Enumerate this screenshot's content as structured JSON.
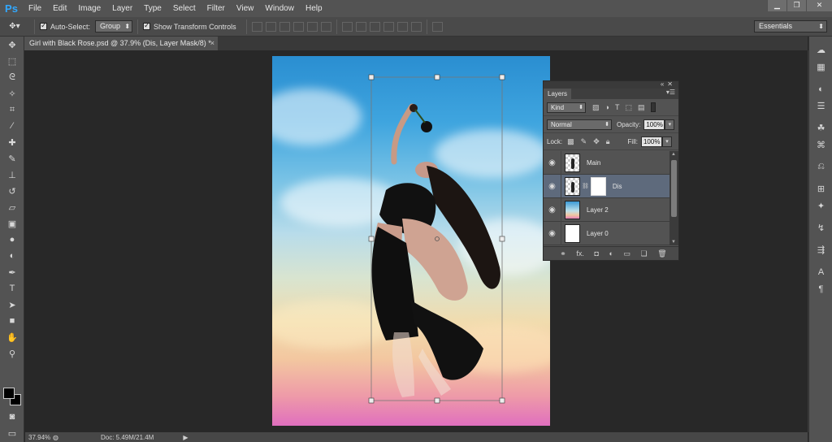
{
  "app": {
    "logo": "Ps"
  },
  "menu": {
    "items": [
      "File",
      "Edit",
      "Image",
      "Layer",
      "Type",
      "Select",
      "Filter",
      "View",
      "Window",
      "Help"
    ]
  },
  "window_controls": {
    "minimize": "▁",
    "restore": "❐",
    "close": "✕"
  },
  "options_bar": {
    "auto_select_label": "Auto-Select:",
    "auto_select_checked": true,
    "auto_select_target": "Group",
    "show_transform_label": "Show Transform Controls",
    "show_transform_checked": true,
    "workspace": "Essentials"
  },
  "document": {
    "tab_title": "Girl with Black Rose.psd @ 37.9% (Dis, Layer Mask/8) *",
    "close": "×"
  },
  "status": {
    "zoom": "37.94%",
    "doc_size": "Doc: 5.49M/21.4M",
    "arrow": "▶"
  },
  "layers_panel": {
    "tab": "Layers",
    "filter_kind": "Kind",
    "blend_mode": "Normal",
    "opacity_label": "Opacity:",
    "opacity_value": "100%",
    "lock_label": "Lock:",
    "fill_label": "Fill:",
    "fill_value": "100%",
    "layers": [
      {
        "name": "Main",
        "thumb": "checker",
        "mask": false,
        "selected": false
      },
      {
        "name": "Dis",
        "thumb": "checker",
        "mask": true,
        "selected": true
      },
      {
        "name": "Layer 2",
        "thumb": "sky",
        "mask": false,
        "selected": false
      },
      {
        "name": "Layer 0",
        "thumb": "white",
        "mask": false,
        "selected": false
      }
    ],
    "bottom_icons": [
      "link-icon",
      "fx-icon",
      "mask-icon",
      "adjustment-icon",
      "folder-icon",
      "new-layer-icon",
      "trash-icon"
    ],
    "fx_label": "fx."
  },
  "colors": {
    "accent": "#31a8ff",
    "selected_layer": "#5e6a7c",
    "panel": "#535353"
  }
}
